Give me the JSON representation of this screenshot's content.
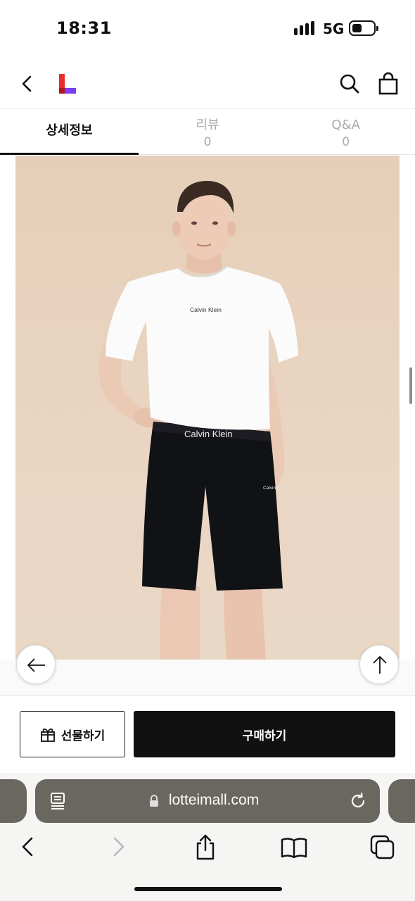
{
  "status_bar": {
    "time": "18:31",
    "network": "5G",
    "battery_level": 0.45
  },
  "header": {
    "icons": [
      "back-arrow-icon",
      "lotte-logo",
      "search-icon",
      "shopping-bag-icon"
    ]
  },
  "tabs": [
    {
      "label": "상세정보",
      "count": "",
      "active": true
    },
    {
      "label": "리뷰",
      "count": "0",
      "active": false
    },
    {
      "label": "Q&A",
      "count": "0",
      "active": false
    }
  ],
  "product_image": {
    "brand_text": "Calvin Klein",
    "waistband_text": "Calvin Klein",
    "shorts_logo_text": "Calvin Klein"
  },
  "action_bar": {
    "gift_label": "선물하기",
    "buy_label": "구매하기"
  },
  "browser": {
    "url": "lotteimall.com"
  },
  "colors": {
    "brand_red": "#e62e2e",
    "brand_purple": "#7a3ff0",
    "buy_button": "#111111",
    "address_bar": "#6a6760"
  }
}
